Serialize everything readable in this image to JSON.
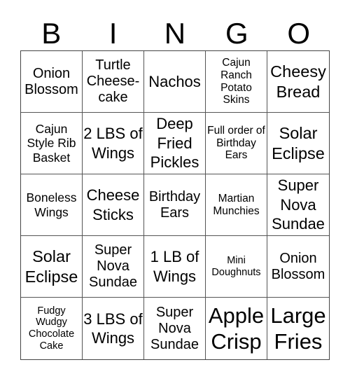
{
  "header": {
    "letters": [
      "B",
      "I",
      "N",
      "G",
      "O"
    ]
  },
  "cells": [
    "Onion Blossom",
    "Turtle Cheese-cake",
    "Nachos",
    "Cajun Ranch Potato Skins",
    "Cheesy Bread",
    "Cajun Style Rib Basket",
    "2 LBS of Wings",
    "Deep Fried Pickles",
    "Full order of Birthday Ears",
    "Solar Eclipse",
    "Boneless Wings",
    "Cheese Sticks",
    "Birthday Ears",
    "Martian Munchies",
    "Super Nova Sundae",
    "Solar Eclipse",
    "Super Nova Sundae",
    "1 LB of Wings",
    "Mini Doughnuts",
    "Onion Blossom",
    "Fudgy Wudgy Chocolate Cake",
    "3 LBS of Wings",
    "Super Nova Sundae",
    "Apple Crisp",
    "Large Fries"
  ]
}
